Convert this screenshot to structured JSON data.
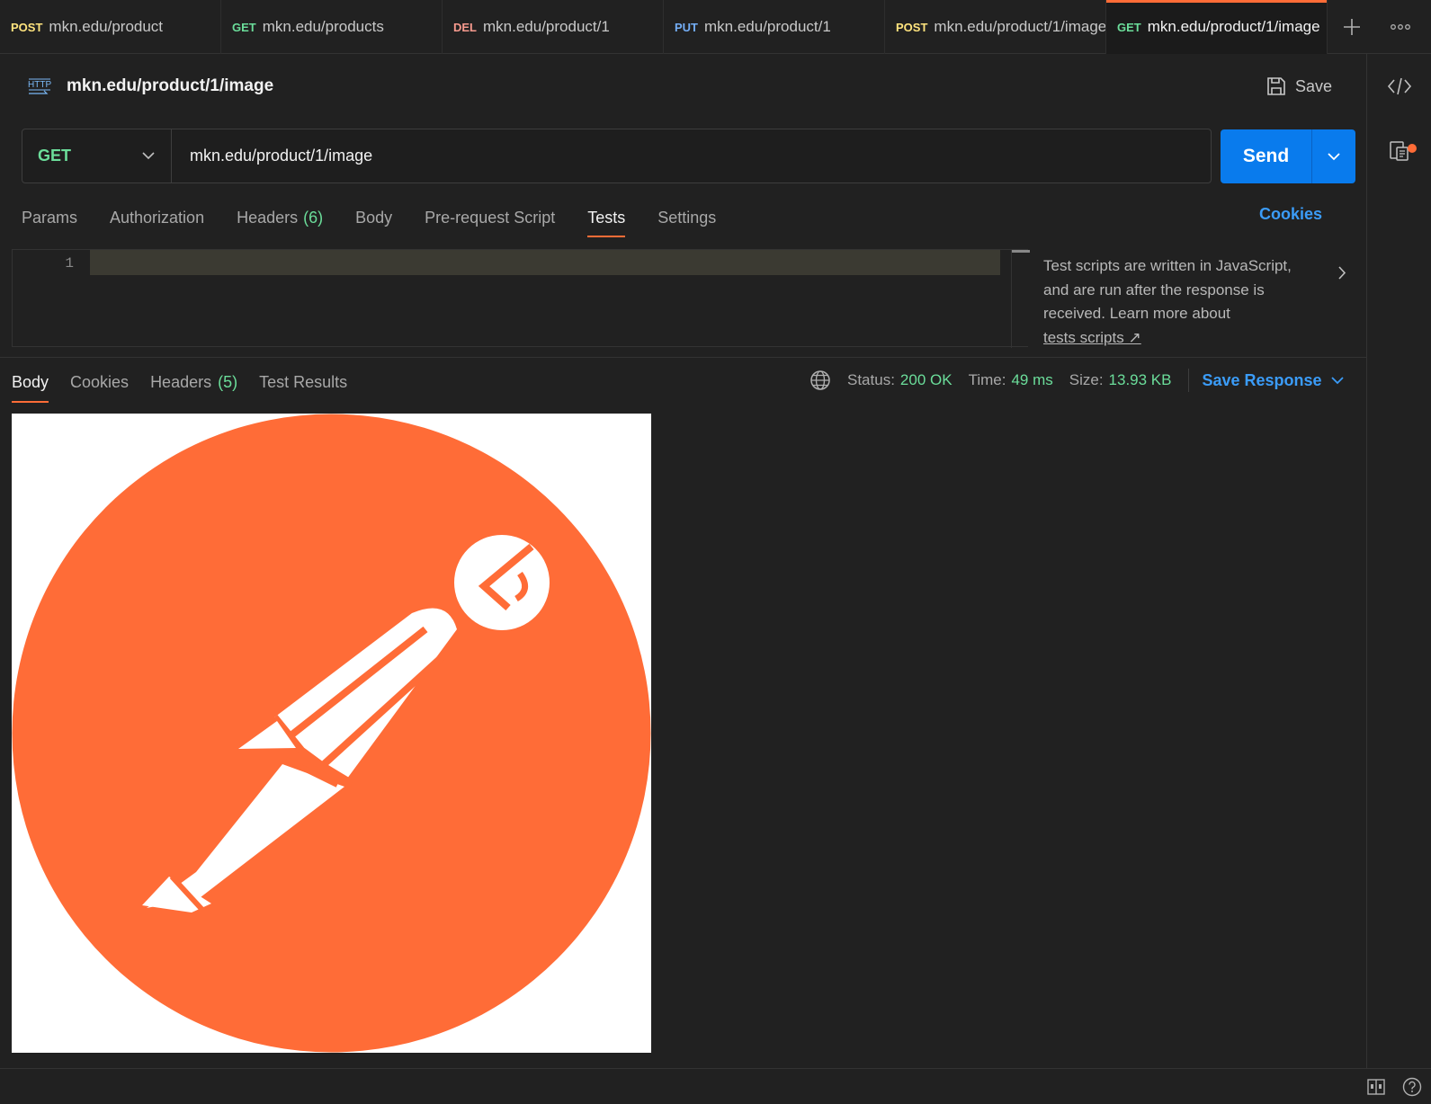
{
  "tabs": [
    {
      "method": "POST",
      "method_color": "#ffe47e",
      "url": "mkn.edu/product"
    },
    {
      "method": "GET",
      "method_color": "#6bdd9a",
      "url": "mkn.edu/products"
    },
    {
      "method": "DEL",
      "method_color": "#f79a8e",
      "url": "mkn.edu/product/1"
    },
    {
      "method": "PUT",
      "method_color": "#74aef6",
      "url": "mkn.edu/product/1"
    },
    {
      "method": "POST",
      "method_color": "#ffe47e",
      "url": "mkn.edu/product/1/image"
    },
    {
      "method": "GET",
      "method_color": "#6bdd9a",
      "url": "mkn.edu/product/1/image",
      "active": true
    }
  ],
  "header": {
    "badge_icon": "http-icon",
    "title": "mkn.edu/product/1/image",
    "save_label": "Save"
  },
  "request": {
    "method": "GET",
    "url": "mkn.edu/product/1/image",
    "send_label": "Send"
  },
  "request_tabs": [
    {
      "label": "Params"
    },
    {
      "label": "Authorization"
    },
    {
      "label": "Headers",
      "count": "(6)"
    },
    {
      "label": "Body"
    },
    {
      "label": "Pre-request Script"
    },
    {
      "label": "Tests",
      "active": true
    },
    {
      "label": "Settings"
    }
  ],
  "cookies_label": "Cookies",
  "editor": {
    "line_number": "1"
  },
  "hint": {
    "text": "Test scripts are written in JavaScript, and are run after the response is received. Learn more about",
    "link": "tests scripts ↗"
  },
  "response_tabs": [
    {
      "label": "Body",
      "active": true
    },
    {
      "label": "Cookies"
    },
    {
      "label": "Headers",
      "count": "(5)"
    },
    {
      "label": "Test Results"
    }
  ],
  "response_status": {
    "status_label": "Status:",
    "status_value": "200 OK",
    "time_label": "Time:",
    "time_value": "49 ms",
    "size_label": "Size:",
    "size_value": "13.93 KB",
    "save_response_label": "Save Response"
  },
  "response_body": {
    "image_description_icon": "postman-logo",
    "accent": "#ff6c37"
  }
}
